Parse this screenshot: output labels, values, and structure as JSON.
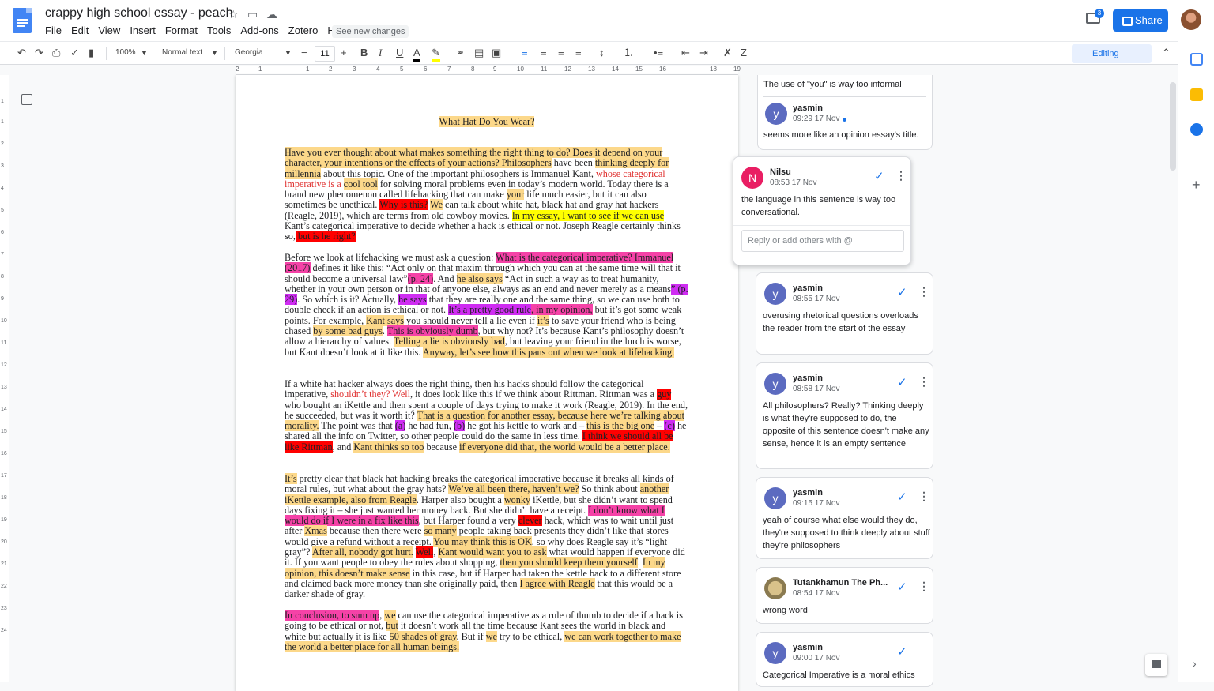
{
  "header": {
    "title": "crappy high school essay - peach",
    "menus": [
      "File",
      "Edit",
      "View",
      "Insert",
      "Format",
      "Tools",
      "Add-ons",
      "Zotero",
      "Help"
    ],
    "see_changes": "See new changes",
    "share_label": "Share",
    "comment_count": "3"
  },
  "toolbar": {
    "zoom": "100%",
    "style": "Normal text",
    "font": "Georgia",
    "font_size": "11",
    "mode": "Editing"
  },
  "ruler": [
    "2",
    "1",
    "1",
    "2",
    "3",
    "4",
    "5",
    "6",
    "7",
    "8",
    "9",
    "10",
    "11",
    "12",
    "13",
    "14",
    "15",
    "16",
    "18",
    "19"
  ],
  "vruler": [
    "1",
    "1",
    "2",
    "3",
    "4",
    "5",
    "6",
    "7",
    "8",
    "9",
    "10",
    "11",
    "12",
    "13",
    "14",
    "15",
    "16",
    "17",
    "18",
    "19",
    "20",
    "21",
    "22",
    "23",
    "24"
  ],
  "doc": {
    "title": "What Hat Do You Wear?",
    "paragraphs": [
      [
        [
          "o",
          "Have you ever thought about what makes something the right thing to do? Does it depend on your character, your intentions or the effects of your actions? Philosophers"
        ],
        [
          "",
          ""
        ],
        [
          "n",
          " have been "
        ],
        [
          "o",
          "thinking deeply for millennia"
        ],
        [
          "n",
          " about this topic. One of the important philosophers is Immanuel Kant, "
        ],
        [
          "red",
          "whose categorical imperative is a "
        ],
        [
          "o",
          "cool tool"
        ],
        [
          "n",
          " for solving moral problems even in today’s modern world. Today there is a brand new phenomenon called lifehacking that can make "
        ],
        [
          "o",
          "your"
        ],
        [
          "n",
          " life much easier, but it can also sometimes be unethical. "
        ],
        [
          "r",
          "Why is this?"
        ],
        [
          "n",
          " "
        ],
        [
          "o",
          "We"
        ],
        [
          "n",
          " can talk about white hat, black hat and gray hat hackers (Reagle, 2019), which are terms from old cowboy movies. "
        ],
        [
          "y",
          "In my essay, I want to see if we can use"
        ],
        [
          "n",
          " Kant’s categorical imperative to decide whether a hack is ethical or not. Joseph Reagle certainly thinks so,"
        ],
        [
          "r",
          " but is he right?"
        ]
      ],
      [
        [
          "n",
          "Before we look at lifehacking we must ask a question: "
        ],
        [
          "p",
          "What is the categorical imperative? Immanuel (2017)"
        ],
        [
          "n",
          " defines it like this: “Act only on that maxim through which you can at the same time will that it should become a universal law”"
        ],
        [
          "p",
          "(p. 24)"
        ],
        [
          "n",
          ". And "
        ],
        [
          "o",
          "he also says"
        ],
        [
          "n",
          " “Act in such a way as to treat humanity, whether in your own person or in that of anyone else, always as an end and never merely as a means"
        ],
        [
          "m",
          "” (p. 29)"
        ],
        [
          "n",
          ". So which is it? Actually, "
        ],
        [
          "m",
          "he says"
        ],
        [
          "n",
          " that they are really one and the same thing, so we can use both to double check if an action is ethical or not. "
        ],
        [
          "m",
          "It’s a pretty good rule"
        ],
        [
          "p",
          ", in my opinion,"
        ],
        [
          "n",
          " but it’s got some weak points. For example, "
        ],
        [
          "o",
          "Kant says"
        ],
        [
          "n",
          " you should never tell a lie even if "
        ],
        [
          "o",
          "it’s"
        ],
        [
          "n",
          " to save your friend who is being chased "
        ],
        [
          "o",
          "by some bad guys"
        ],
        [
          "n",
          ". "
        ],
        [
          "p",
          "This is obviously dumb"
        ],
        [
          "n",
          ", but why not? It’s because Kant’s philosophy doesn’t allow a hierarchy of values. "
        ],
        [
          "o",
          "Telling a lie is obviously bad"
        ],
        [
          "n",
          ", but leaving your friend in the lurch is worse, but Kant doesn’t look at it like this. "
        ],
        [
          "o",
          "Anyway, let’s see how this pans out when we look at lifehacking."
        ]
      ],
      [
        [
          "n",
          "If a white hat hacker always does the right thing, then his hacks should follow the categorical imperative, "
        ],
        [
          "red",
          "shouldn’t they? Well"
        ],
        [
          "n",
          ", it does look like this if we think about Rittman. Rittman was a "
        ],
        [
          "r",
          "guy"
        ],
        [
          "n",
          " who bought an iKettle and then spent a couple of days trying to make it work (Reagle, 2019). In the end, he succeeded, but was it worth it? "
        ],
        [
          "o",
          "That is a question for another essay, because here we’re talking about morality."
        ],
        [
          "n",
          " The point was that "
        ],
        [
          "m",
          "(a)"
        ],
        [
          "n",
          " he had fun, "
        ],
        [
          "m",
          "(b)"
        ],
        [
          "n",
          " he got his kettle to work and – "
        ],
        [
          "o",
          "this is the big one"
        ],
        [
          "n",
          " – "
        ],
        [
          "m",
          "(c)"
        ],
        [
          "n",
          " he shared all the info on Twitter, so other people could do the same in less time. "
        ],
        [
          "r",
          "I think we should all be like Rittman"
        ],
        [
          "n",
          ", and "
        ],
        [
          "o",
          "Kant thinks so too"
        ],
        [
          "n",
          " because "
        ],
        [
          "o",
          "if everyone did that, the world would be a better place."
        ]
      ],
      [
        [
          "o",
          "It’s"
        ],
        [
          "n",
          " pretty clear that black hat hacking breaks the categorical imperative because it breaks all kinds of moral rules, but what about the gray hats? "
        ],
        [
          "o",
          "We’ve all been there, haven’t we?"
        ],
        [
          "n",
          " So think about "
        ],
        [
          "o",
          "another iKettle example, also from Reagle"
        ],
        [
          "n",
          ". Harper also bought a "
        ],
        [
          "o",
          "wonky"
        ],
        [
          "n",
          " iKettle, but she didn’t want to spend days fixing it – she just wanted her money back. But she didn’t have a receipt. "
        ],
        [
          "p",
          "I don’t know what I would do if I were in a fix like this"
        ],
        [
          "n",
          ", but Harper found a very "
        ],
        [
          "r",
          "clever"
        ],
        [
          "n",
          " hack, which was to wait until just after "
        ],
        [
          "o",
          "Xmas"
        ],
        [
          "n",
          " because then there were "
        ],
        [
          "o",
          "so many"
        ],
        [
          "n",
          " people taking back presents they didn’t like that stores would give a refund without a receipt. "
        ],
        [
          "o",
          "You may think this is OK"
        ],
        [
          "n",
          ", so why does Reagle say it’s “light gray”? "
        ],
        [
          "o",
          "After all, nobody got hurt."
        ],
        [
          "n",
          " "
        ],
        [
          "r",
          "Well"
        ],
        [
          "n",
          ", "
        ],
        [
          "o",
          "Kant would want you to ask"
        ],
        [
          "n",
          " what would happen if everyone did it. If you want people to obey the rules about shopping, "
        ],
        [
          "o",
          "then you should keep them yourself"
        ],
        [
          "n",
          ". "
        ],
        [
          "o",
          "In my opinion, this doesn’t make sense"
        ],
        [
          "n",
          " in this case, but if Harper had taken the kettle back to a different store and claimed back more money than she originally paid, then "
        ],
        [
          "o",
          "I agree with Reagle"
        ],
        [
          "n",
          " that this would be a darker shade of gray."
        ]
      ],
      [
        [
          "p",
          "In conclusion, to sum up"
        ],
        [
          "n",
          ", "
        ],
        [
          "o",
          "we"
        ],
        [
          "n",
          " can use the categorical imperative as a rule of thumb to decide if a hack is going to be ethical or not, "
        ],
        [
          "o",
          "but"
        ],
        [
          "n",
          " it doesn’t work all the time because Kant sees the world in black and white but actually it is like "
        ],
        [
          "o",
          "50 shades of gray"
        ],
        [
          "n",
          ". But if "
        ],
        [
          "o",
          "we"
        ],
        [
          "n",
          " try to be ethical, "
        ],
        [
          "o",
          "we can work together to make the world a better place for all human beings."
        ]
      ]
    ]
  },
  "comments": [
    {
      "text": "The use of \"you\" is way too informal",
      "author": "yasmin",
      "time": "09:29 17 Nov",
      "body": "seems more like an opinion essay's title.",
      "initial": "y"
    },
    {
      "author": "Nilsu",
      "time": "08:53 17 Nov",
      "body": "the language in this sentence is way too conversational.",
      "initial": "N",
      "reply_placeholder": "Reply or add others with @"
    },
    {
      "author": "yasmin",
      "time": "08:55 17 Nov",
      "body": "overusing rhetorical questions overloads the reader from the start of the essay",
      "initial": "y"
    },
    {
      "author": "yasmin",
      "time": "08:58 17 Nov",
      "body": "All philosophers? Really? Thinking deeply is what they're supposed to do, the opposite of this sentence doesn't make any sense, hence it is an empty sentence",
      "initial": "y"
    },
    {
      "author": "yasmin",
      "time": "09:15 17 Nov",
      "body": "yeah of course what else would they do, they're supposed to think deeply about stuff they're philosophers",
      "initial": "y"
    },
    {
      "author": "Tutankhamun The Ph...",
      "time": "08:54 17 Nov",
      "body": "wrong word",
      "initial": ""
    },
    {
      "author": "yasmin",
      "time": "09:00 17 Nov",
      "body": "Categorical Imperative is a moral ethics",
      "initial": "y"
    }
  ],
  "colors": {
    "accent": "#1a73e8",
    "highlight_orange": "#fcd88a",
    "highlight_yellow": "#ffff00",
    "highlight_red": "#ff0000",
    "highlight_pink": "#f542a7",
    "highlight_magenta": "#cf2cf2"
  }
}
